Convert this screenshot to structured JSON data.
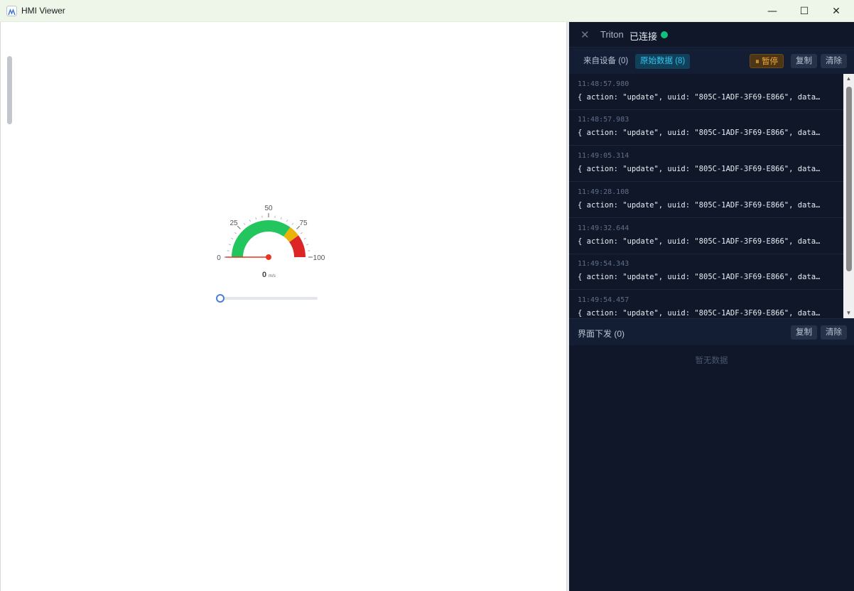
{
  "window": {
    "title": "HMI Viewer",
    "minimize_glyph": "—",
    "maximize_glyph": "☐",
    "close_glyph": "✕"
  },
  "gauge": {
    "ticks": {
      "t0": "0",
      "t25": "25",
      "t50": "50",
      "t75": "75",
      "t100": "100"
    },
    "value": "0",
    "unit": "m/s",
    "min": 0,
    "max": 100,
    "current": 0,
    "colors": {
      "green": "#22c55e",
      "yellow": "#eab308",
      "red": "#dc2626",
      "needle": "#e8351f"
    }
  },
  "slider": {
    "value": 0
  },
  "panel": {
    "close_glyph": "✕",
    "name": "Triton",
    "status": "已连接",
    "status_color": "#10c27b",
    "tabs": {
      "device": "来自设备 (0)",
      "raw": "原始数据 (8)"
    },
    "pause": "⏸ 暂停",
    "copy": "复制",
    "clear": "清除",
    "logs": [
      {
        "time": "11:48:57.980",
        "text": "{ action: \"update\", uuid: \"805C-1ADF-3F69-E866\", data: …"
      },
      {
        "time": "11:48:57.983",
        "text": "{ action: \"update\", uuid: \"805C-1ADF-3F69-E866\", data: …"
      },
      {
        "time": "11:49:05.314",
        "text": "{ action: \"update\", uuid: \"805C-1ADF-3F69-E866\", data: …"
      },
      {
        "time": "11:49:28.108",
        "text": "{ action: \"update\", uuid: \"805C-1ADF-3F69-E866\", data: …"
      },
      {
        "time": "11:49:32.644",
        "text": "{ action: \"update\", uuid: \"805C-1ADF-3F69-E866\", data: …"
      },
      {
        "time": "11:49:54.343",
        "text": "{ action: \"update\", uuid: \"805C-1ADF-3F69-E866\", data: …"
      },
      {
        "time": "11:49:54.457",
        "text": "{ action: \"update\", uuid: \"805C-1ADF-3F69-E866\", data: …"
      }
    ],
    "scroll_up": "▲",
    "scroll_down": "▼",
    "outbound_title": "界面下发 (0)",
    "empty_text": "暂无数据"
  }
}
